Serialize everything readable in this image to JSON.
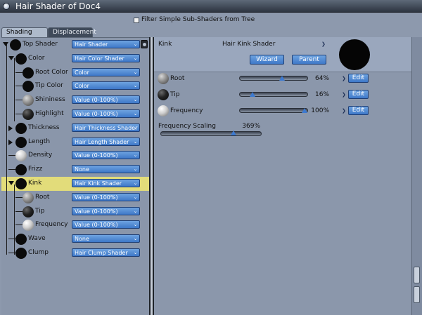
{
  "window": {
    "title": "Hair Shader of Doc4"
  },
  "filter": {
    "label": "Filter Simple Sub-Shaders from Tree",
    "checked": false
  },
  "tabs": [
    {
      "label": "Shading",
      "active": true
    },
    {
      "label": "Displacement",
      "active": false
    }
  ],
  "tree": [
    {
      "label": "Top Shader",
      "shader": "Hair Shader",
      "ball": "black",
      "expanded": true
    },
    {
      "label": "Color",
      "shader": "Hair Color Shader",
      "ball": "black",
      "expanded": true
    },
    {
      "label": "Root Color",
      "shader": "Color",
      "ball": "black"
    },
    {
      "label": "Tip Color",
      "shader": "Color",
      "ball": "black"
    },
    {
      "label": "Shininess",
      "shader": "Value (0-100%)",
      "ball": "gray"
    },
    {
      "label": "Highlight",
      "shader": "Value (0-100%)",
      "ball": "dark"
    },
    {
      "label": "Thickness",
      "shader": "Hair Thickness Shader",
      "ball": "black",
      "expanded": false
    },
    {
      "label": "Length",
      "shader": "Hair Length Shader",
      "ball": "black",
      "expanded": false
    },
    {
      "label": "Density",
      "shader": "Value (0-100%)",
      "ball": "light"
    },
    {
      "label": "Frizz",
      "shader": "None",
      "ball": "black"
    },
    {
      "label": "Kink",
      "shader": "Hair Kink Shader",
      "ball": "black",
      "expanded": true,
      "selected": true
    },
    {
      "label": "Root",
      "shader": "Value (0-100%)",
      "ball": "gray"
    },
    {
      "label": "Tip",
      "shader": "Value (0-100%)",
      "ball": "dark"
    },
    {
      "label": "Frequency",
      "shader": "Value (0-100%)",
      "ball": "light"
    },
    {
      "label": "Wave",
      "shader": "None",
      "ball": "black"
    },
    {
      "label": "Clump",
      "shader": "Hair Clump Shader",
      "ball": "black"
    }
  ],
  "detail": {
    "name": "Kink",
    "shader_type": "Hair Kink Shader",
    "wizard_label": "Wizard",
    "parent_label": "Parent",
    "params": [
      {
        "label": "Root",
        "value": "64%",
        "level": 0.64,
        "ball": "gray",
        "edit_label": "Edit"
      },
      {
        "label": "Tip",
        "value": "16%",
        "level": 0.16,
        "ball": "dark",
        "edit_label": "Edit"
      },
      {
        "label": "Frequency",
        "value": "100%",
        "level": 1.0,
        "ball": "light",
        "edit_label": "Edit"
      }
    ],
    "frequency_scaling": {
      "label": "Frequency Scaling",
      "value": "369%",
      "level": 0.74
    }
  },
  "colors": {
    "accent": "#3e78c8",
    "selected_row": "#e2dc7a",
    "panel": "#8b97ab"
  }
}
